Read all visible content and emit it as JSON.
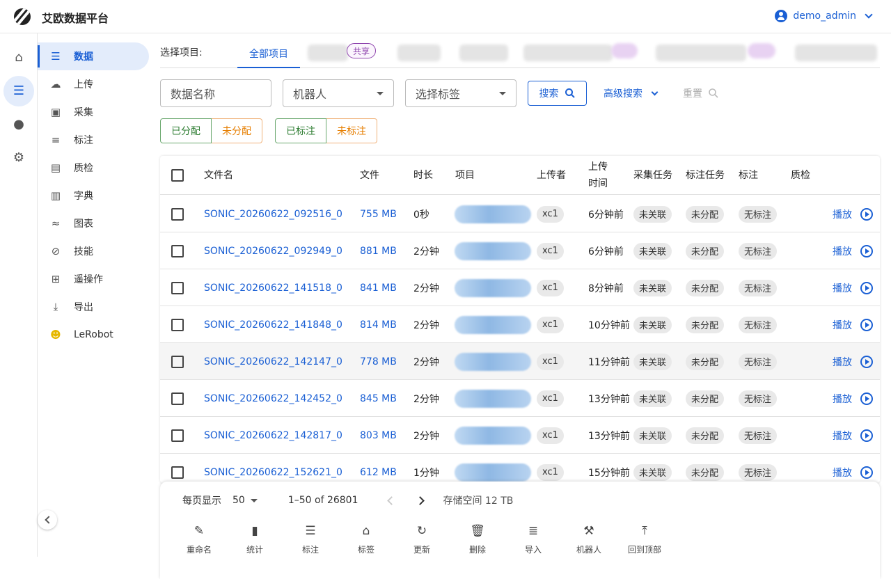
{
  "header": {
    "app_title": "艾欧数据平台",
    "user": "demo_admin"
  },
  "rail": [
    {
      "icon": "home-icon",
      "glyph": "⌂"
    },
    {
      "icon": "data-icon",
      "glyph": "☰"
    },
    {
      "icon": "brain-icon",
      "glyph": "●"
    },
    {
      "icon": "settings-icon",
      "glyph": "⚙"
    }
  ],
  "sidebar": {
    "items": [
      {
        "label": "数据",
        "icon": "list-icon",
        "glyph": "☰"
      },
      {
        "label": "上传",
        "icon": "cloud-upload-icon",
        "glyph": "☁"
      },
      {
        "label": "采集",
        "icon": "video-icon",
        "glyph": "▣"
      },
      {
        "label": "标注",
        "icon": "checklist-icon",
        "glyph": "≡"
      },
      {
        "label": "质检",
        "icon": "folder-check-icon",
        "glyph": "▤"
      },
      {
        "label": "字典",
        "icon": "book-icon",
        "glyph": "▥"
      },
      {
        "label": "图表",
        "icon": "chart-icon",
        "glyph": "≈"
      },
      {
        "label": "技能",
        "icon": "skill-icon",
        "glyph": "⊘"
      },
      {
        "label": "遥操作",
        "icon": "gamepad-icon",
        "glyph": "⊞"
      },
      {
        "label": "导出",
        "icon": "download-icon",
        "glyph": "⤓"
      },
      {
        "label": "LeRobot",
        "icon": "robot-face-icon",
        "glyph": "☻"
      }
    ]
  },
  "projects": {
    "label": "选择项目:",
    "all_tab": "全部项目",
    "share_badge": "共享"
  },
  "filters": {
    "name_placeholder": "数据名称",
    "robot_placeholder": "机器人",
    "tag_placeholder": "选择标签",
    "search": "搜索",
    "advanced": "高级搜索",
    "reset": "重置",
    "assigned": "已分配",
    "unassigned": "未分配",
    "labeled": "已标注",
    "unlabeled": "未标注"
  },
  "table": {
    "headers": {
      "filename": "文件名",
      "file": "文件",
      "duration": "时长",
      "project": "项目",
      "uploader": "上传者",
      "upload_time": "上传时间",
      "collect_task": "采集任务",
      "label_task": "标注任务",
      "label": "标注",
      "qc": "质检"
    },
    "rows": [
      {
        "name": "SONIC_20260622_092516_0",
        "size": "755 MB",
        "duration": "0秒",
        "uploader": "xc1",
        "time": "6分钟前",
        "collect": "未关联",
        "assign": "未分配",
        "label": "无标注",
        "play": "播放"
      },
      {
        "name": "SONIC_20260622_092949_0",
        "size": "881 MB",
        "duration": "2分钟",
        "uploader": "xc1",
        "time": "6分钟前",
        "collect": "未关联",
        "assign": "未分配",
        "label": "无标注",
        "play": "播放"
      },
      {
        "name": "SONIC_20260622_141518_0",
        "size": "841 MB",
        "duration": "2分钟",
        "uploader": "xc1",
        "time": "8分钟前",
        "collect": "未关联",
        "assign": "未分配",
        "label": "无标注",
        "play": "播放"
      },
      {
        "name": "SONIC_20260622_141848_0",
        "size": "814 MB",
        "duration": "2分钟",
        "uploader": "xc1",
        "time": "10分钟前",
        "collect": "未关联",
        "assign": "未分配",
        "label": "无标注",
        "play": "播放"
      },
      {
        "name": "SONIC_20260622_142147_0",
        "size": "778 MB",
        "duration": "2分钟",
        "uploader": "xc1",
        "time": "11分钟前",
        "collect": "未关联",
        "assign": "未分配",
        "label": "无标注",
        "play": "播放"
      },
      {
        "name": "SONIC_20260622_142452_0",
        "size": "845 MB",
        "duration": "2分钟",
        "uploader": "xc1",
        "time": "13分钟前",
        "collect": "未关联",
        "assign": "未分配",
        "label": "无标注",
        "play": "播放"
      },
      {
        "name": "SONIC_20260622_142817_0",
        "size": "803 MB",
        "duration": "2分钟",
        "uploader": "xc1",
        "time": "13分钟前",
        "collect": "未关联",
        "assign": "未分配",
        "label": "无标注",
        "play": "播放"
      },
      {
        "name": "SONIC_20260622_152621_0",
        "size": "612 MB",
        "duration": "1分钟",
        "uploader": "xc1",
        "time": "15分钟前",
        "collect": "未关联",
        "assign": "未分配",
        "label": "无标注",
        "play": "播放"
      }
    ]
  },
  "pagination": {
    "per_page_label": "每页显示",
    "per_page": "50",
    "range": "1–50 of 26801",
    "storage": "存储空间 12 TB"
  },
  "actions": [
    {
      "label": "重命名",
      "icon": "rename-icon",
      "glyph": "✎"
    },
    {
      "label": "统计",
      "icon": "bar-chart-icon",
      "glyph": "▮"
    },
    {
      "label": "标注",
      "icon": "checklist-icon",
      "glyph": "☰"
    },
    {
      "label": "标签",
      "icon": "tag-icon",
      "glyph": "⌂"
    },
    {
      "label": "更新",
      "icon": "refresh-icon",
      "glyph": "↻"
    },
    {
      "label": "删除",
      "icon": "trash-icon",
      "glyph": "🗑"
    },
    {
      "label": "导入",
      "icon": "import-icon",
      "glyph": "≣"
    },
    {
      "label": "机器人",
      "icon": "robot-arm-icon",
      "glyph": "⚒"
    },
    {
      "label": "回到顶部",
      "icon": "to-top-icon",
      "glyph": "⤒"
    }
  ],
  "colors": {
    "accent": "#1a5fd4",
    "green": "#2e7d32",
    "orange": "#e67e00",
    "purple": "#8e44ad"
  }
}
